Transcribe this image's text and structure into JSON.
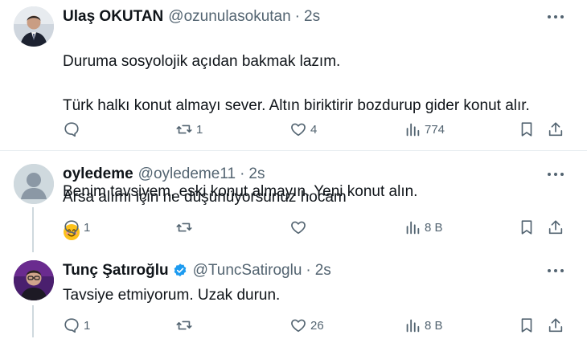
{
  "tweets": [
    {
      "name": "Ulaş OKUTAN",
      "handle": "@ozunulasokutan",
      "dot": "·",
      "time": "2s",
      "verified": false,
      "lines": [
        "Duruma sosyolojik açıdan bakmak lazım.",
        "Türk halkı konut almayı sever.  Altın biriktirir bozdurup gider konut alır.",
        "",
        "Benim tavsiyem, eski konut almayın. Yeni konut alın."
      ],
      "emoji": "smiling-face-emoji",
      "replies": "",
      "retweets": "1",
      "likes": "4",
      "views": "774"
    },
    {
      "name": "oyledeme",
      "handle": "@oyledeme11",
      "dot": "·",
      "time": "2s",
      "verified": false,
      "text": "Arsa alımı için ne düşünüyorsunuz hocam",
      "replies": "1",
      "retweets": "",
      "likes": "",
      "views": "8 B"
    },
    {
      "name": "Tunç Şatıroğlu",
      "handle": "@TuncSatiroglu",
      "dot": "·",
      "time": "2s",
      "verified": true,
      "text": "Tavsiye etmiyorum. Uzak durun.",
      "replies": "1",
      "retweets": "",
      "likes": "26",
      "views": "8 B"
    }
  ],
  "icons": {
    "more": "more-horizontal-icon",
    "reply": "reply-bubble-icon",
    "retweet": "retweet-icon",
    "like": "heart-icon",
    "views": "views-bar-chart-icon",
    "bookmark": "bookmark-icon",
    "share": "share-upload-icon",
    "verified": "verified-badge-icon"
  },
  "colors": {
    "text": "#0f1419",
    "secondary": "#536471",
    "verified": "#1d9bf0",
    "thread_line": "#cfd9de"
  }
}
